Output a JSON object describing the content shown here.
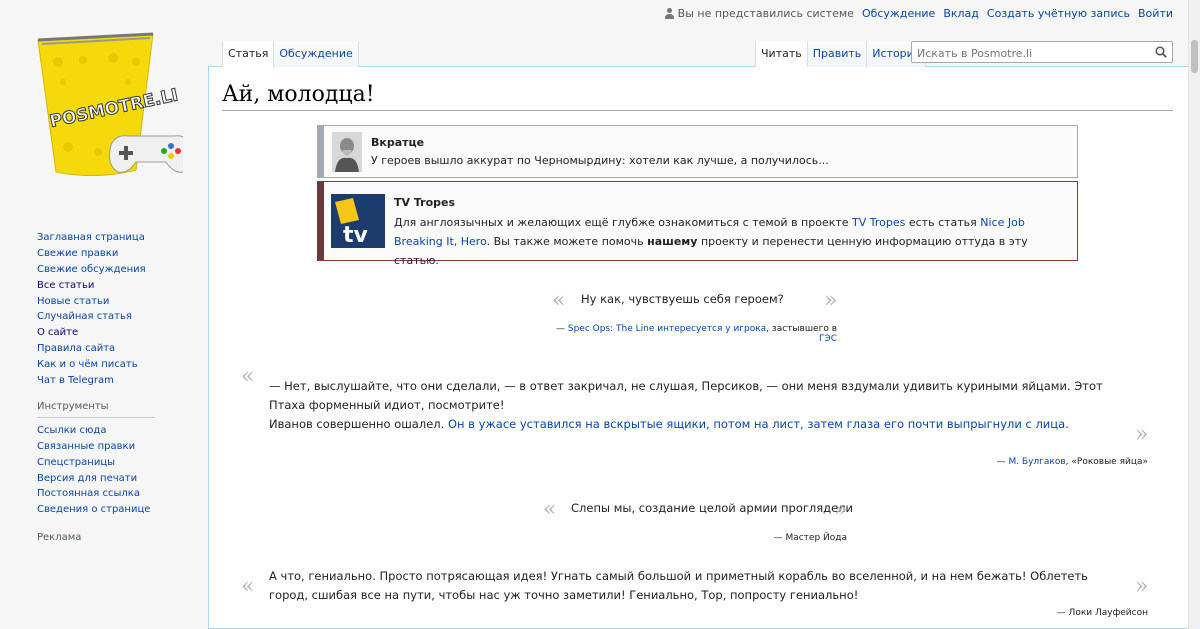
{
  "personal": {
    "anon": "Вы не представились системе",
    "talk": "Обсуждение",
    "contrib": "Вклад",
    "create": "Создать учётную запись",
    "login": "Войти"
  },
  "logo": {
    "text": "POSMOTRE.LI"
  },
  "sidebar": {
    "nav": [
      "Заглавная страница",
      "Свежие правки",
      "Свежие обсуждения",
      "Все статьи",
      "Новые статьи",
      "Случайная статья",
      "О сайте",
      "Правила сайта",
      "Как и о чём писать",
      "Чат в Telegram"
    ],
    "tools_heading": "Инструменты",
    "tools": [
      "Ссылки сюда",
      "Связанные правки",
      "Спецстраницы",
      "Версия для печати",
      "Постоянная ссылка",
      "Сведения о странице"
    ],
    "ads_heading": "Реклама"
  },
  "tabs": {
    "article": "Статья",
    "discussion": "Обсуждение",
    "read": "Читать",
    "edit": "Править",
    "history": "История"
  },
  "search": {
    "placeholder": "Искать в Posmotre.li"
  },
  "title": "Ай, молодца!",
  "box1": {
    "title": "Вкратце",
    "text": "У героев вышло аккурат по Черномырдину: хотели как лучше, а получилось..."
  },
  "box2": {
    "title": "TV Tropes",
    "logo_text": "tv",
    "pre": "Для англоязычных и желающих ещё глубже ознакомиться с темой в проекте ",
    "link1": "TV Tropes",
    "mid": " есть статья ",
    "link2": "Nice Job Breaking It, Hero",
    "post1": ". Вы также можете помочь ",
    "bold": "нашему",
    "post2": " проекту и перенести ценную информацию оттуда в эту статью."
  },
  "quotes": [
    {
      "text": "Ну как, чувствуешь себя героем?",
      "cite_link": "Spec Ops: The Line интересуется у игрока",
      "cite_rest": ", застывшего в ",
      "cite_link2": "ГЭС"
    },
    {
      "line1": "— Нет, выслушайте, что они сделали, — в ответ закричал, не слушая, Персиков, — они меня вздумали удивить куриными яйцами. Этот Птаха форменный идиот, посмотрите!",
      "line2a": "Иванов совершенно ошалел. ",
      "line2b": "Он в ужасе уставился на вскрытые ящики, потом на лист, затем глаза его почти выпрыгнули с лица.",
      "cite_link": "М. Булгаков",
      "cite_rest": ", «Роковые яйца»"
    },
    {
      "text": "Слепы мы, создание целой армии проглядели",
      "cite": "— Мастер Йода"
    },
    {
      "text": "А что, гениально. Просто потрясающая идея! Угнать самый большой и приметный корабль во вселенной, и на нем бежать! Облететь город, сшибая все на пути, чтобы нас уж точно заметили! Гениально, Тор, попросту гениально!",
      "cite": "— Локи Лауфейсон"
    }
  ],
  "colors": {
    "link": "#0645ad",
    "box2_border": "#8b3a3a"
  }
}
